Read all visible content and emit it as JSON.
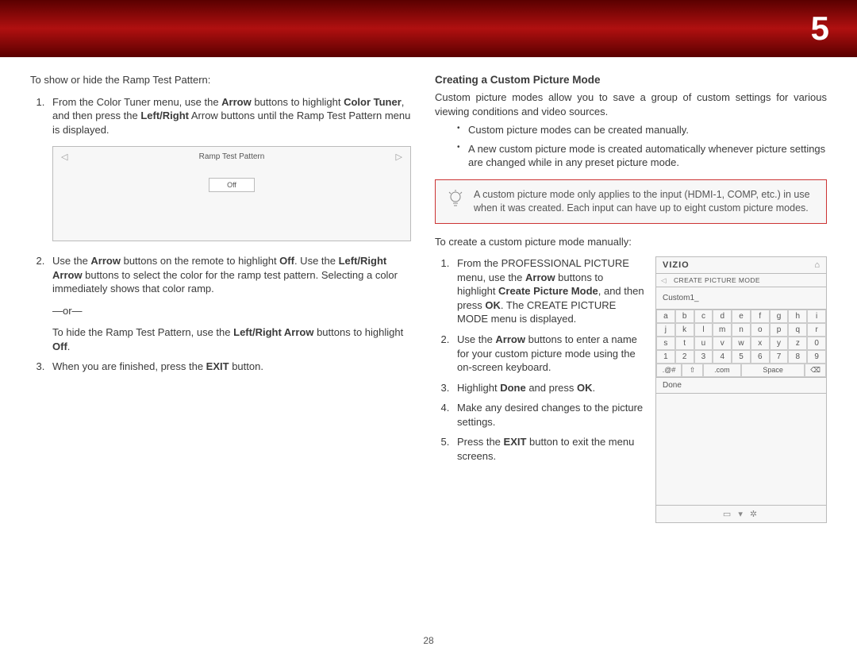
{
  "chapter_number": "5",
  "left": {
    "intro": "To show or hide the Ramp Test Pattern:",
    "step1_a": "From the Color Tuner menu, use the ",
    "step1_b": "Arrow",
    "step1_c": " buttons to highlight ",
    "step1_d": "Color Tuner",
    "step1_e": ", and then press the ",
    "step1_f": "Left/Right",
    "step1_g": " Arrow buttons until the Ramp Test Pattern menu is displayed.",
    "ramp_title": "Ramp Test Pattern",
    "ramp_off": "Off",
    "step2_a": "Use the ",
    "step2_b": "Arrow",
    "step2_c": " buttons on the remote to highlight ",
    "step2_d": "Off",
    "step2_e": ". Use the ",
    "step2_f": "Left/Right Arrow",
    "step2_g": " buttons to select the color for the ramp test pattern. Selecting a color immediately shows that color ramp.",
    "or": "—or—",
    "step2_h": "To hide the Ramp Test Pattern, use the ",
    "step2_i": "Left/Right Arrow",
    "step2_j": " buttons to highlight ",
    "step2_k": "Off",
    "step2_l": ".",
    "step3_a": "When you are finished, press the ",
    "step3_b": "EXIT",
    "step3_c": " button."
  },
  "right": {
    "heading": "Creating a Custom Picture Mode",
    "intro": "Custom picture modes allow you to save a group of custom settings for various viewing conditions and video sources.",
    "bullet1": "Custom picture modes can be created manually.",
    "bullet2": "A new custom picture mode is created automatically whenever picture settings are changed while in any preset picture mode.",
    "hint": "A custom picture mode only applies to the input (HDMI-1, COMP, etc.) in use when it was created. Each input can have up to eight custom picture modes.",
    "intro2": "To create a custom picture mode manually:",
    "s1_a": "From the PROFESSIONAL PICTURE menu, use the ",
    "s1_b": "Arrow",
    "s1_c": " buttons to highlight ",
    "s1_d": "Create Picture Mode",
    "s1_e": ", and then press ",
    "s1_f": "OK",
    "s1_g": ". The CREATE PICTURE MODE menu is displayed.",
    "s2_a": "Use the ",
    "s2_b": "Arrow",
    "s2_c": " buttons to enter a name for your custom picture mode using the on-screen keyboard.",
    "s3_a": "Highlight ",
    "s3_b": "Done",
    "s3_c": " and press ",
    "s3_d": "OK",
    "s3_e": ".",
    "s4": "Make any desired changes to the picture settings.",
    "s5_a": "Press the ",
    "s5_b": "EXIT",
    "s5_c": " button to exit the menu screens."
  },
  "osd": {
    "logo": "VIZIO",
    "breadcrumb": "CREATE PICTURE MODE",
    "input_value": "Custom1_",
    "keys_r1": [
      "a",
      "b",
      "c",
      "d",
      "e",
      "f",
      "g",
      "h",
      "i"
    ],
    "keys_r2": [
      "j",
      "k",
      "l",
      "m",
      "n",
      "o",
      "p",
      "q",
      "r"
    ],
    "keys_r3": [
      "s",
      "t",
      "u",
      "v",
      "w",
      "x",
      "y",
      "z",
      "0"
    ],
    "keys_r4": [
      "1",
      "2",
      "3",
      "4",
      "5",
      "6",
      "7",
      "8",
      "9"
    ],
    "bottom": [
      ".@#",
      "⇧",
      ".com",
      "Space",
      "⌫"
    ],
    "done": "Done",
    "footer": "▭  ▾  ✲"
  },
  "page_number": "28"
}
